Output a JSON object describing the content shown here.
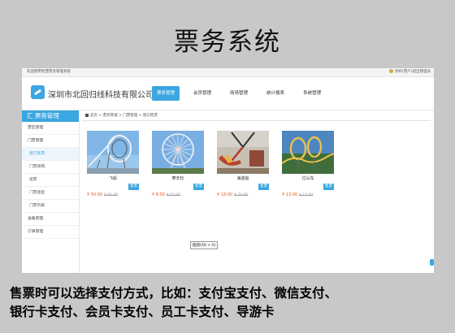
{
  "slide": {
    "title": "票务系统",
    "caption_line1": "售票时可以选择支付方式，比如：支付宝支付、微信支付、",
    "caption_line2": "银行卡支付、会员卡支付、员工卡支付、导游卡"
  },
  "app": {
    "topbar": {
      "welcome": "欢迎使用智慧票务管理系统",
      "user": "你好(用户)退出管理员"
    },
    "company": "深圳市北回归线科技有限公司",
    "nav": [
      "票务管理",
      "会员管理",
      "商场管理",
      "统计报表",
      "系统管理"
    ],
    "nav_active": 0,
    "sidebar": {
      "heading": "汇 票务管理",
      "items": [
        {
          "label": "票区管理",
          "sub": false
        },
        {
          "label": "门票管理",
          "sub": false
        },
        {
          "label": "窗口售票",
          "sub": true,
          "active": true
        },
        {
          "label": "门票核销",
          "sub": true
        },
        {
          "label": "退票",
          "sub": true
        },
        {
          "label": "门票类型",
          "sub": true
        },
        {
          "label": "门票列表",
          "sub": true
        },
        {
          "label": "设备管理",
          "sub": false
        },
        {
          "label": "订单管理",
          "sub": false
        }
      ]
    },
    "breadcrumb": "首页 > 票务管理 > 门票管理 > 窗口售票",
    "tickets": [
      {
        "name": "飞船",
        "price": "¥ 50.00",
        "old_price": "¥ 60.00",
        "button": "售票"
      },
      {
        "name": "摩天轮",
        "price": "¥ 8.00",
        "old_price": "¥ 15.00",
        "button": "售票"
      },
      {
        "name": "海盗船",
        "price": "¥ 18.00",
        "old_price": "¥ 20.00",
        "button": "售票"
      },
      {
        "name": "过山车",
        "price": "¥ 13.00",
        "old_price": "¥ 15.00",
        "button": "售票"
      }
    ],
    "tooltip": "截图(Alt + A)"
  },
  "colors": {
    "accent": "#3ba6e0",
    "price": "#e35a1c",
    "background": "#c8c8c8"
  },
  "icons": [
    "logo-icon",
    "home-icon",
    "user-icon"
  ]
}
